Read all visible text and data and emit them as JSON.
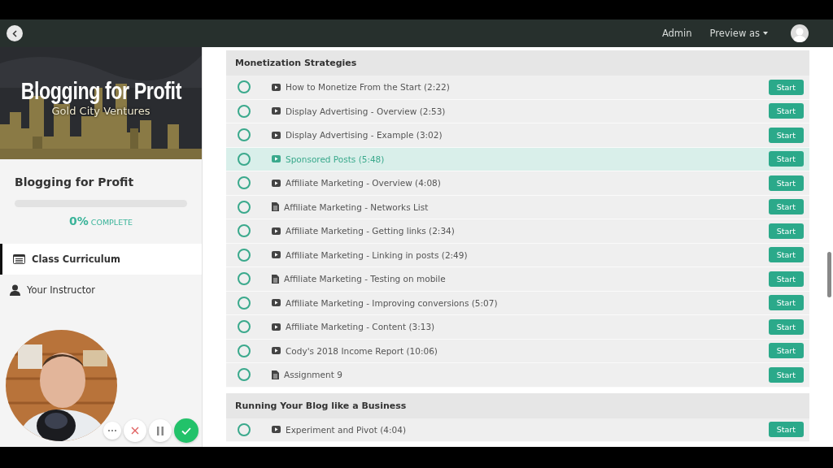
{
  "topbar": {
    "links": [
      {
        "label": "Admin",
        "kind": "link"
      },
      {
        "label": "Preview as",
        "kind": "dropdown"
      }
    ]
  },
  "sidebar": {
    "banner": {
      "title": "Blogging for Profit",
      "subtitle": "Gold City Ventures"
    },
    "course_title": "Blogging for Profit",
    "progress": {
      "level": 0,
      "percent": "0%",
      "label": "COMPLETE"
    },
    "nav": [
      {
        "label": "Class Curriculum",
        "kind": "list",
        "selected": true
      },
      {
        "label": "Your Instructor",
        "kind": "person",
        "selected": false
      }
    ],
    "webcam_controls": [
      {
        "kind": "more"
      },
      {
        "kind": "cancel"
      },
      {
        "kind": "pause"
      },
      {
        "kind": "confirm"
      }
    ]
  },
  "sections": [
    {
      "title": "Monetization Strategies",
      "lessons": [
        {
          "title": "How to Monetize From the Start (2:22)",
          "kind": "video",
          "completed": false,
          "highlighted": false,
          "button": "Start"
        },
        {
          "title": "Display Advertising - Overview (2:53)",
          "kind": "video",
          "completed": false,
          "highlighted": false,
          "button": "Start"
        },
        {
          "title": "Display Advertising - Example (3:02)",
          "kind": "video",
          "completed": false,
          "highlighted": false,
          "button": "Start"
        },
        {
          "title": "Sponsored Posts (5:48)",
          "kind": "video",
          "completed": false,
          "highlighted": true,
          "button": "Start"
        },
        {
          "title": "Affiliate Marketing - Overview (4:08)",
          "kind": "video",
          "completed": false,
          "highlighted": false,
          "button": "Start"
        },
        {
          "title": "Affiliate Marketing - Networks List",
          "kind": "document",
          "completed": false,
          "highlighted": false,
          "button": "Start"
        },
        {
          "title": "Affiliate Marketing - Getting links (2:34)",
          "kind": "video",
          "completed": false,
          "highlighted": false,
          "button": "Start"
        },
        {
          "title": "Affiliate Marketing - Linking in posts (2:49)",
          "kind": "video",
          "completed": false,
          "highlighted": false,
          "button": "Start"
        },
        {
          "title": "Affiliate Marketing - Testing on mobile",
          "kind": "document",
          "completed": false,
          "highlighted": false,
          "button": "Start"
        },
        {
          "title": "Affiliate Marketing - Improving conversions (5:07)",
          "kind": "video",
          "completed": false,
          "highlighted": false,
          "button": "Start"
        },
        {
          "title": "Affiliate Marketing - Content (3:13)",
          "kind": "video",
          "completed": false,
          "highlighted": false,
          "button": "Start"
        },
        {
          "title": "Cody's 2018 Income Report (10:06)",
          "kind": "video",
          "completed": false,
          "highlighted": false,
          "button": "Start"
        },
        {
          "title": "Assignment 9",
          "kind": "document",
          "completed": false,
          "highlighted": false,
          "button": "Start"
        }
      ]
    },
    {
      "title": "Running Your Blog like a Business",
      "lessons": [
        {
          "title": "Experiment and Pivot (4:04)",
          "kind": "video",
          "completed": false,
          "highlighted": false,
          "button": "Start"
        }
      ]
    }
  ]
}
